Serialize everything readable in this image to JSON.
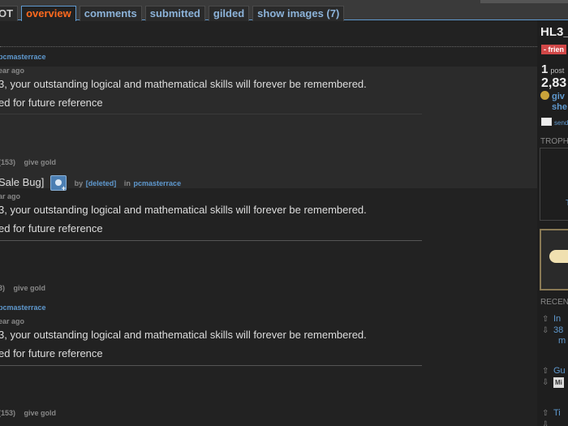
{
  "tabs": [
    {
      "label": "OT",
      "active": false
    },
    {
      "label": "overview",
      "active": true
    },
    {
      "label": "comments",
      "active": false
    },
    {
      "label": "submitted",
      "active": false
    },
    {
      "label": "gilded",
      "active": false
    },
    {
      "label": "show images (7)",
      "active": false
    }
  ],
  "entries": [
    {
      "subreddit": "pcmasterrace",
      "time": "ear ago",
      "line1": "3, your outstanding logical and mathematical skills will forever be remembered.",
      "line2": "ed for future reference",
      "footer_count": "(153)",
      "footer_action": "give gold"
    },
    {
      "title": "Sale Bug]",
      "by_label": "by",
      "author": "[deleted]",
      "in_label": "in",
      "subreddit": "pcmasterrace",
      "time": "ar ago",
      "line1": "3, your outstanding logical and mathematical skills will forever be remembered.",
      "line2": "ed for future reference",
      "footer_count": "3)",
      "footer_action": "give gold"
    },
    {
      "subreddit": "pcmasterrace",
      "time": "ear ago",
      "line1": "3, your outstanding logical and mathematical skills will forever be remembered.",
      "line2": "ed for future reference",
      "footer_count": "(153)",
      "footer_action": "give gold"
    }
  ],
  "sidebar": {
    "username": "HL3_",
    "friend": "- frien",
    "post_karma_num": "1",
    "post_karma_label": "post",
    "comment_karma": "2,83",
    "gild_line1": "giv",
    "gild_line2": "she",
    "send": "send",
    "trophy_heading": "TROPH",
    "trophy_text": "T",
    "recent_heading": "RECENT",
    "recent_items": [
      {
        "text": "In"
      },
      {
        "text": "38"
      },
      {
        "text": "m"
      },
      {
        "text": "Gu"
      },
      {
        "text": "Mi"
      },
      {
        "text": "Ti"
      }
    ]
  },
  "colors": {
    "accent_orange": "#ff6a1e",
    "link_blue": "#5f99cf",
    "friend_red": "#d14848"
  }
}
